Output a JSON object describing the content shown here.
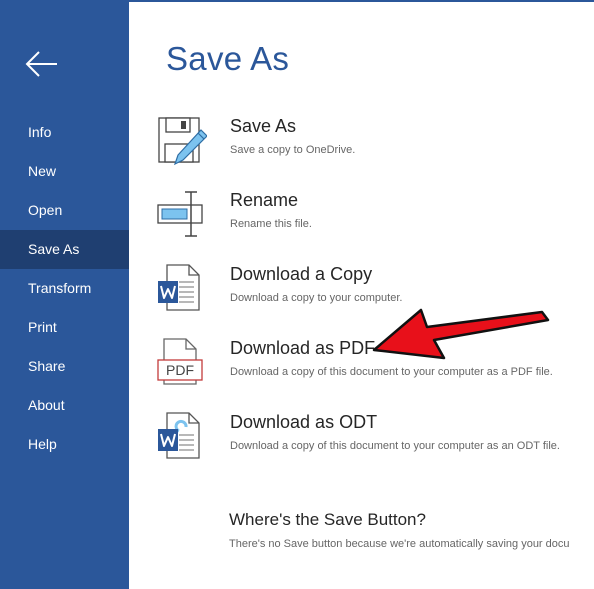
{
  "sidebar": {
    "back_icon": "arrow-left-icon",
    "items": [
      {
        "label": "Info"
      },
      {
        "label": "New"
      },
      {
        "label": "Open"
      },
      {
        "label": "Save As",
        "active": true
      },
      {
        "label": "Transform"
      },
      {
        "label": "Print"
      },
      {
        "label": "Share"
      },
      {
        "label": "About"
      },
      {
        "label": "Help"
      }
    ]
  },
  "main": {
    "title": "Save As",
    "options": [
      {
        "label": "Save As",
        "description": "Save a copy to OneDrive.",
        "icon": "save-disk-pencil-icon"
      },
      {
        "label": "Rename",
        "description": "Rename this file.",
        "icon": "rename-textbox-icon"
      },
      {
        "label": "Download a Copy",
        "description": "Download a copy to your computer.",
        "icon": "word-document-icon"
      },
      {
        "label": "Download as PDF",
        "description": "Download a copy of this document to your computer as a PDF file.",
        "icon": "pdf-document-icon"
      },
      {
        "label": "Download as ODT",
        "description": "Download a copy of this document to your computer as an ODT file.",
        "icon": "odt-document-icon"
      }
    ],
    "info": {
      "title": "Where's the Save Button?",
      "description": "There's no Save button because we're automatically saving your docu"
    }
  },
  "pdf_icon_text": "PDF",
  "annotation": {
    "icon": "red-pointer-arrow-icon"
  },
  "colors": {
    "sidebar": "#2b579a",
    "sidebar_active": "#1f3f71",
    "title": "#2b579a",
    "annotation_arrow": "#e8101a"
  }
}
